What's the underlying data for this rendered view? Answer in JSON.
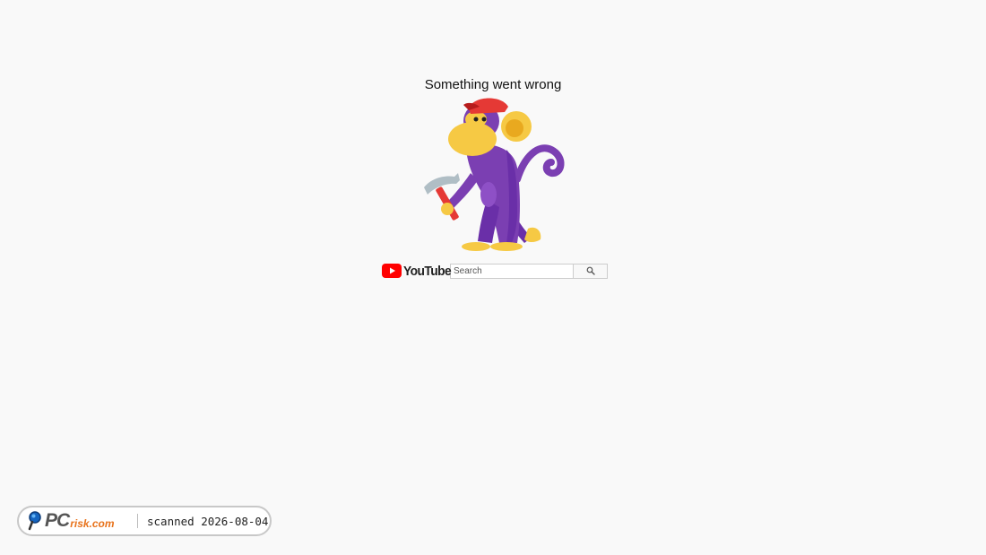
{
  "error": {
    "message": "Something went wrong"
  },
  "illustration": {
    "icon": "monkey-with-hammer-illustration"
  },
  "header": {
    "logo_text": "YouTube",
    "logo_icon": "youtube-play-icon",
    "brand_color": "#ff0000"
  },
  "search": {
    "placeholder": "Search",
    "value": "",
    "button_icon": "search-icon"
  },
  "watermark": {
    "brand_prefix": "PC",
    "brand_suffix": "risk.com",
    "scanned_text": "scanned 2026-08-04",
    "accent_color": "#e8731c"
  }
}
